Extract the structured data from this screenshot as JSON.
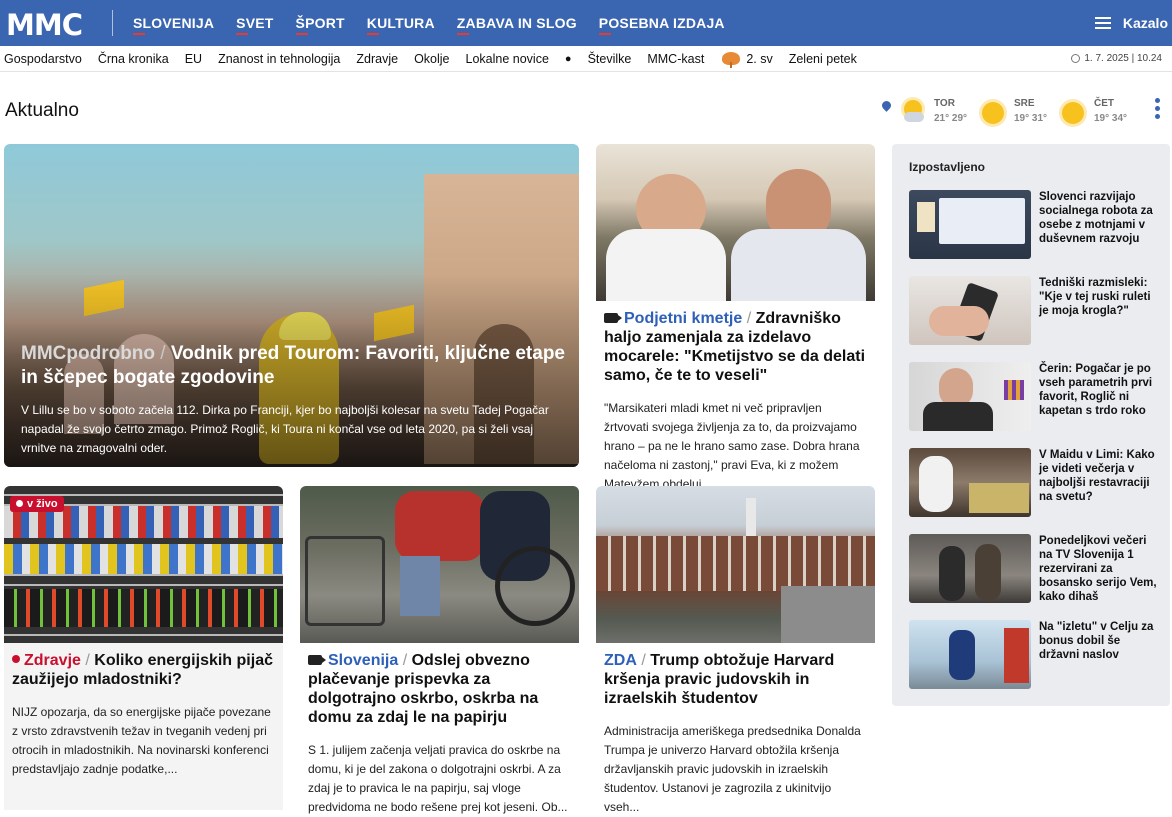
{
  "header": {
    "logo": "MMC",
    "nav": [
      "SLOVENIJA",
      "SVET",
      "ŠPORT",
      "KULTURA",
      "ZABAVA IN SLOG",
      "POSEBNA IZDAJA"
    ],
    "menu_label": "Kazalo"
  },
  "subnav": {
    "items": [
      "Gospodarstvo",
      "Črna kronika",
      "EU",
      "Znanost in tehnologija",
      "Zdravje",
      "Okolje",
      "Lokalne novice"
    ],
    "after_bullet": [
      "Številke",
      "MMC-kast"
    ],
    "kiwi_label": "2. sv",
    "last": "Zeleni petek",
    "datetime": "1. 7. 2025 | 10.24"
  },
  "section_title": "Aktualno",
  "weather": [
    {
      "day": "TOR",
      "temps": "21° 29°",
      "icon": "partly-cloudy-icon"
    },
    {
      "day": "SRE",
      "temps": "19° 31°",
      "icon": "sun-icon"
    },
    {
      "day": "ČET",
      "temps": "19° 34°",
      "icon": "sun-icon"
    }
  ],
  "hero": {
    "kicker": "MMCpodrobno",
    "title": "Vodnik pred Tourom: Favoriti, ključne etape in ščepec bogate zgodovine",
    "summary": "V Lillu se bo v soboto začela 112. Dirka po Franciji, kjer bo najboljši kolesar na svetu Tadej Pogačar napadal že svojo četrto zmago. Primož Roglič, ki Toura ni končal vse od leta 2020, pa si želi vsaj vrnitve na zmagovalni oder."
  },
  "cards": {
    "farm": {
      "kicker": "Podjetni kmetje",
      "title": "Zdravniško haljo zamenjala za izdelavo mocarele: \"Kmetijstvo se da delati samo, če te to veseli\"",
      "summary": "\"Marsikateri mladi kmet ni več pripravljen žrtvovati svojega življenja za to, da proizvajamo hrano – pa ne le hrano samo zase. Dobra hrana načeloma ni zastonj,\" pravi Eva, ki z možem Matevžem obdeluj..."
    },
    "energy": {
      "live": "v živo",
      "kicker": "Zdravje",
      "title": "Koliko energijskih pijač zaužijejo mladostniki?",
      "summary": "NIJZ opozarja, da so energijske pijače povezane z vrsto zdravstvenih težav in tveganih vedenj pri otrocih in mladostnikih. Na novinarski konferenci predstavljajo zadnje podatke,..."
    },
    "care": {
      "kicker": "Slovenija",
      "title": "Odslej obvezno plačevanje prispevka za dolgotrajno oskrbo, oskrba na domu za zdaj le na papirju",
      "summary": "S 1. julijem začenja veljati pravica do oskrbe na domu, ki je del zakona o dolgotrajni oskrbi. A za zdaj je to pravica le na papirju, saj vloge predvidoma ne bodo rešene prej kot jeseni. Ob..."
    },
    "harvard": {
      "kicker": "ZDA",
      "title": "Trump obtožuje Harvard kršenja pravic judovskih in izraelskih študentov",
      "summary": "Administracija ameriškega predsednika Donalda Trumpa je univerzo Harvard obtožila kršenja državljanskih pravic judovskih in izraelskih študentov. Ustanovi je zagrozila z ukinitvijo vseh..."
    }
  },
  "sidebar": {
    "title": "Izpostavljeno",
    "items": [
      "Slovenci razvijajo socialnega robota za osebe z motnjami v duševnem razvoju",
      "Tedniški razmisleki: \"Kje v tej ruski ruleti je moja krogla?\"",
      "Čerin: Pogačar je po vseh parametrih prvi favorit, Roglič ni kapetan s trdo roko",
      "V Maidu v Limi: Kako je videti večerja v najboljši restavraciji na svetu?",
      "Ponedeljkovi večeri na TV Slovenija 1 rezervirani za bosansko serijo Vem, kako dihaš",
      "Na \"izletu\" v Celju za bonus dobil še državni naslov"
    ]
  },
  "colors": {
    "brand": "#3a65b0",
    "accent": "#c8102e",
    "link": "#2f60b8"
  }
}
